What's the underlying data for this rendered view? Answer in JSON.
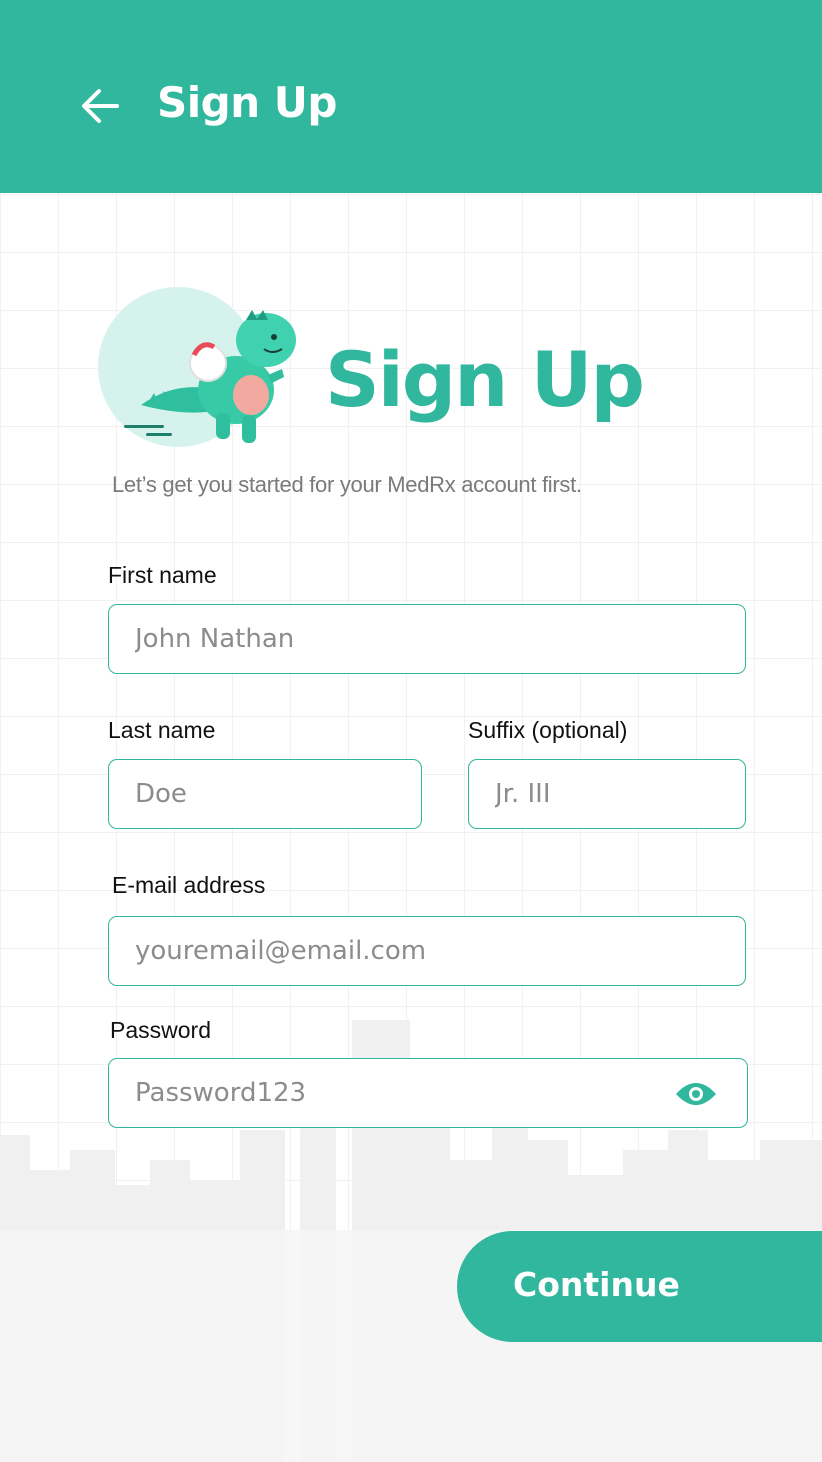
{
  "header": {
    "title": "Sign Up",
    "back_icon": "arrow-left-icon"
  },
  "hero": {
    "title": "Sign Up",
    "subtitle": "Let’s get you started for your MedRx account first.",
    "mascot": "dinosaur-mascot"
  },
  "form": {
    "first_name": {
      "label": "First name",
      "placeholder": "John Nathan"
    },
    "last_name": {
      "label": "Last name",
      "placeholder": "Doe"
    },
    "suffix": {
      "label": "Suffix (optional)",
      "placeholder": "Jr. III"
    },
    "email": {
      "label": "E-mail address",
      "placeholder": "youremail@email.com"
    },
    "password": {
      "label": "Password",
      "placeholder": "Password123",
      "toggle_icon": "eye-icon"
    }
  },
  "actions": {
    "continue_label": "Continue"
  },
  "colors": {
    "primary": "#31b79d",
    "label_text": "#111111",
    "placeholder_text": "#8c8c8c",
    "subtitle_text": "#7a7a7a"
  }
}
